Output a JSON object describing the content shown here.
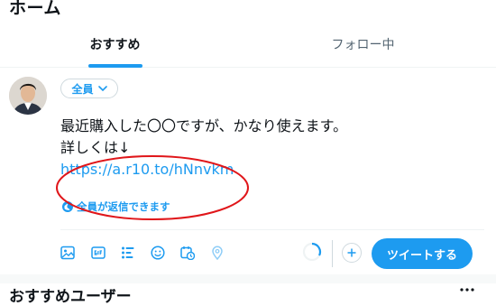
{
  "header": {
    "title": "ホーム"
  },
  "tabs": [
    {
      "label": "おすすめ",
      "active": true
    },
    {
      "label": "フォロー中",
      "active": false
    }
  ],
  "composer": {
    "audience_label": "全員",
    "text_lines": [
      "最近購入した〇〇ですが、かなり使えます。",
      "詳しくは↓"
    ],
    "link": "https://a.r10.to/hNnvkm",
    "reply_setting": "全員が返信できます",
    "toolbar_icons": [
      "image-icon",
      "gif-icon",
      "poll-icon",
      "emoji-icon",
      "schedule-icon",
      "location-icon"
    ],
    "tweet_button": "ツイートする"
  },
  "suggestions": {
    "title": "おすすめユーザー"
  },
  "colors": {
    "accent": "#1d9bf0",
    "text": "#0f1419",
    "muted": "#536471",
    "annotation": "#e0161a"
  }
}
